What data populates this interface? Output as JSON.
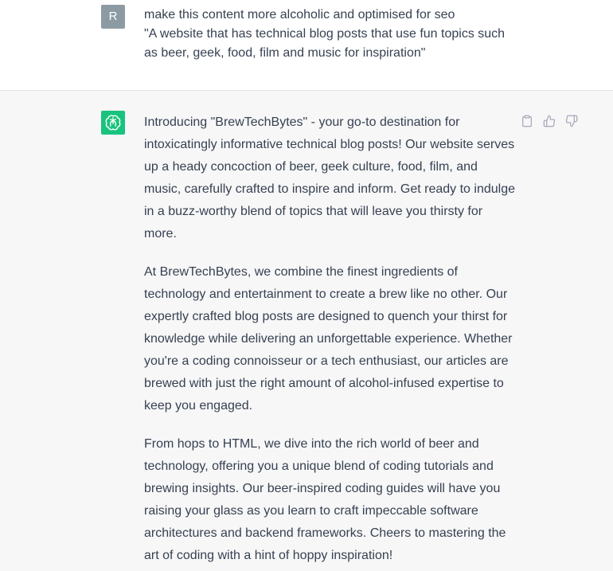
{
  "user_message": {
    "avatar_letter": "R",
    "lines": [
      "make this content more alcoholic and optimised for seo",
      "\"A website that has technical blog posts that use fun topics such as beer, geek, food, film and music for inspiration\""
    ]
  },
  "assistant_message": {
    "paragraphs": [
      "Introducing \"BrewTechBytes\" - your go-to destination for intoxicatingly informative technical blog posts! Our website serves up a heady concoction of beer, geek culture, food, film, and music, carefully crafted to inspire and inform. Get ready to indulge in a buzz-worthy blend of topics that will leave you thirsty for more.",
      "At BrewTechBytes, we combine the finest ingredients of technology and entertainment to create a brew like no other. Our expertly crafted blog posts are designed to quench your thirst for knowledge while delivering an unforgettable experience. Whether you're a coding connoisseur or a tech enthusiast, our articles are brewed with just the right amount of alcohol-infused expertise to keep you engaged.",
      "From hops to HTML, we dive into the rich world of beer and technology, offering you a unique blend of coding tutorials and brewing insights. Our beer-inspired coding guides will have you raising your glass as you learn to craft impeccable software architectures and backend frameworks. Cheers to mastering the art of coding with a hint of hoppy inspiration!"
    ]
  },
  "icons": {
    "assistant_avatar": "openai-logo-icon",
    "copy": "clipboard-icon",
    "like": "thumbs-up-icon",
    "dislike": "thumbs-down-icon"
  },
  "colors": {
    "assistant_accent": "#19c37d",
    "user_avatar_bg": "#8c9aa3",
    "assistant_bg": "#f7f7f8",
    "text": "#374151"
  }
}
